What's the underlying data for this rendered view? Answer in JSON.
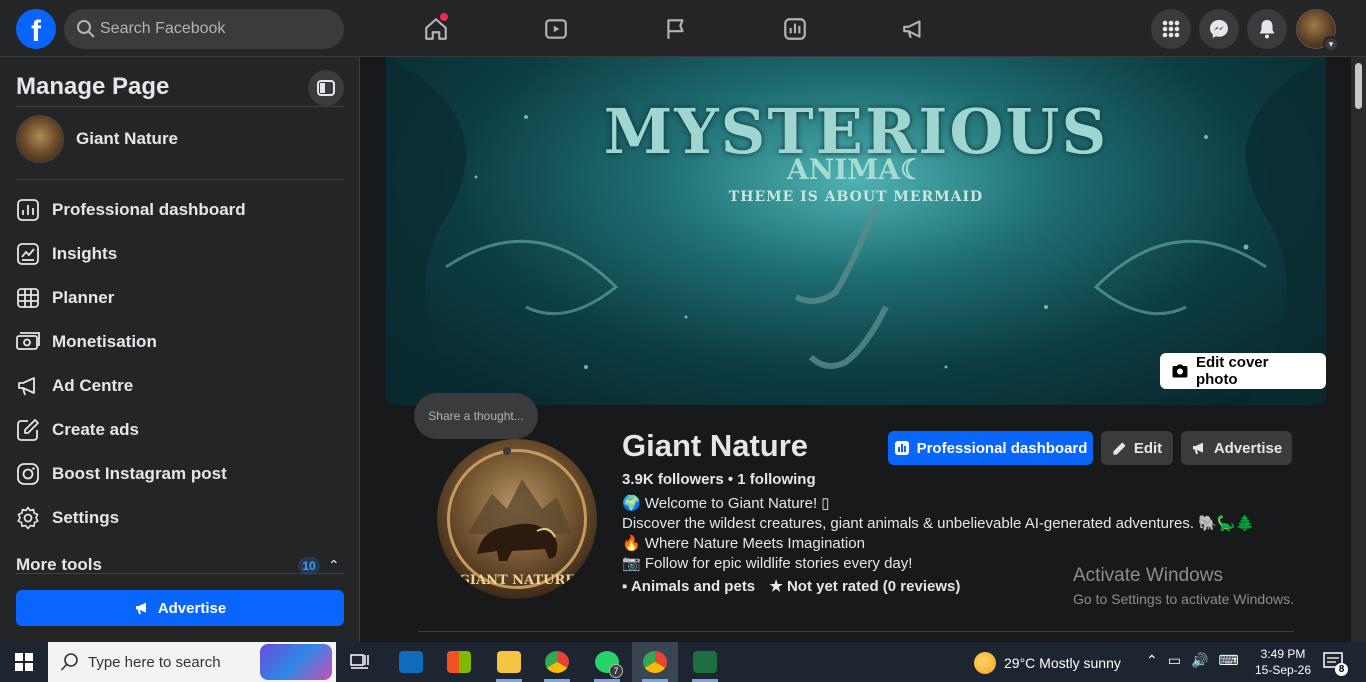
{
  "topbar": {
    "logo": "f",
    "search_placeholder": "Search Facebook",
    "nav_icons": [
      "home-icon",
      "video-icon",
      "flag-icon",
      "dashboard-icon",
      "megaphone-icon"
    ],
    "right_icons": [
      "menu-grid-icon",
      "messenger-icon",
      "bell-icon"
    ]
  },
  "sidebar": {
    "title": "Manage Page",
    "page_name": "Giant Nature",
    "items": [
      {
        "label": "Professional dashboard",
        "icon": "dashboard-icon"
      },
      {
        "label": "Insights",
        "icon": "insights-icon"
      },
      {
        "label": "Planner",
        "icon": "planner-icon"
      },
      {
        "label": "Monetisation",
        "icon": "monetisation-icon"
      },
      {
        "label": "Ad Centre",
        "icon": "megaphone-icon"
      },
      {
        "label": "Create ads",
        "icon": "pencil-square-icon"
      },
      {
        "label": "Boost Instagram post",
        "icon": "instagram-icon"
      },
      {
        "label": "Settings",
        "icon": "gear-icon"
      }
    ],
    "more_tools": "More tools",
    "more_tools_count": "10",
    "advertise_label": "Advertise"
  },
  "cover": {
    "title": "MYSTERIOUS",
    "subtitle": "ANIMA☾",
    "tagline": "THEME IS ABOUT MERMAID",
    "edit_label": "Edit cover photo"
  },
  "profile": {
    "thought_placeholder": "Share a thought...",
    "picture_text": "\"GIANT NATURE\"",
    "name": "Giant Nature",
    "stats": "3.9K followers • 1 following",
    "bio": [
      "🌍 Welcome to Giant Nature! ▯",
      "Discover the wildest creatures, giant animals & unbelievable AI-generated adventures. 🐘🦕🌲",
      "🔥 Where Nature Meets Imagination",
      "📷 Follow for epic wildlife stories every day!"
    ],
    "category": "Animals and pets",
    "rating": "Not yet rated (0 reviews)",
    "buttons": {
      "dashboard": "Professional dashboard",
      "edit": "Edit",
      "advertise": "Advertise"
    }
  },
  "watermark": {
    "line1": "Activate Windows",
    "line2": "Go to Settings to activate Windows."
  },
  "taskbar": {
    "search_placeholder": "Type here to search",
    "apps": [
      "task-view",
      "outlook",
      "store",
      "file-explorer",
      "chrome",
      "whatsapp",
      "chrome-profile",
      "excel"
    ],
    "whatsapp_badge": "7",
    "weather": "29°C  Mostly sunny",
    "time": "3:49 PM",
    "date": "15-Sep-26",
    "notification_count": "8"
  },
  "colors": {
    "accent": "#0866ff",
    "background": "#18191a",
    "surface": "#242526"
  }
}
